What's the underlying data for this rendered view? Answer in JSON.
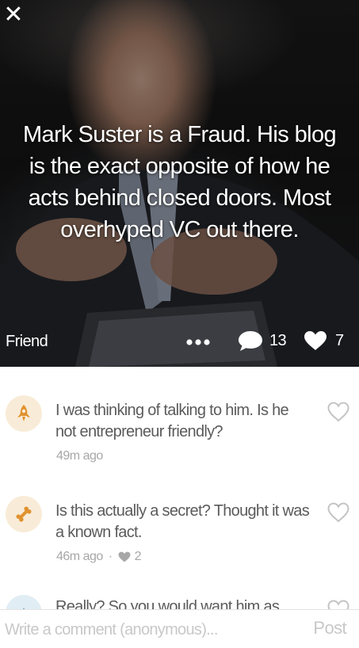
{
  "header": {
    "close_icon": "close-icon",
    "close_glyph": "✕"
  },
  "post": {
    "text": "Mark Suster is a Fraud. His blog is the exact opposite of how he acts behind closed doors. Most overhyped VC out there.",
    "author_label": "Friend",
    "comment_count": "13",
    "like_count": "7",
    "more_icon": "ellipsis-icon",
    "comment_icon": "speech-bubble-icon",
    "like_icon": "heart-icon"
  },
  "comments": [
    {
      "text": "I was thinking of talking to him. Is he not entrepreneur friendly?",
      "time": "49m ago",
      "likes": "",
      "avatar_icon": "rocket-icon",
      "avatar_color": "#f8ecd8",
      "icon_color": "#e0922f"
    },
    {
      "text": "Is this actually a secret? Thought  it was a known fact.",
      "time": "46m ago",
      "likes": "2",
      "avatar_icon": "bone-icon",
      "avatar_color": "#f8ecd8",
      "icon_color": "#e0922f"
    },
    {
      "text": "Really? So you would want him as well...",
      "time": "",
      "likes": "",
      "avatar_icon": "crown-icon",
      "avatar_color": "#e1edf4",
      "icon_color": "#5a8fb5"
    }
  ],
  "composer": {
    "placeholder": "Write a comment (anonymous)...",
    "post_label": "Post"
  },
  "colors": {
    "text_primary": "#5b5b5b",
    "text_muted": "#a7a7a7",
    "accent_orange": "#e0922f"
  }
}
